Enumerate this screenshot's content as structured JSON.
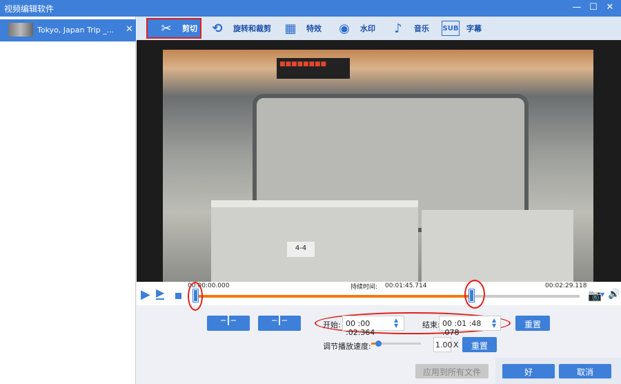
{
  "window": {
    "title": "视频编辑软件",
    "minimize": "—",
    "maximize": "☐",
    "close": "✕"
  },
  "sidebar": {
    "items": [
      {
        "label": "Tokyo, Japan Trip _...",
        "close": "✕"
      }
    ]
  },
  "tabs": [
    {
      "label": "剪切",
      "icon": "scissors-icon",
      "active": true
    },
    {
      "label": "旋转和裁剪",
      "icon": "crop-rotate-icon"
    },
    {
      "label": "特效",
      "icon": "effects-icon"
    },
    {
      "label": "水印",
      "icon": "watermark-icon"
    },
    {
      "label": "音乐",
      "icon": "music-icon"
    },
    {
      "label": "字幕",
      "icon": "subtitle-icon"
    }
  ],
  "video": {
    "sign_text": "■■■■■■■■",
    "platform_label": "4-4"
  },
  "player": {
    "start_time": "00:00:00.000",
    "duration_label": "持续时间:",
    "duration": "00:01:45.714",
    "end_time": "00:02:29.118",
    "trim_start_pct": 0,
    "trim_end_pct": 72
  },
  "trim": {
    "start_label": "开始:",
    "start_value": "00 :00 :02.364",
    "end_label": "结束:",
    "end_value": "00 :01 :48 .078",
    "reset": "重置"
  },
  "speed": {
    "label": "调节播放速度:",
    "value": "1.00",
    "unit": "X",
    "reset": "重置",
    "level": 0.05
  },
  "footer": {
    "apply_all": "应用到所有文件",
    "ok": "好",
    "cancel": "取消"
  },
  "colors": {
    "accent": "#3d7fd9",
    "progress": "#f27a12",
    "highlight": "#e0201a"
  }
}
